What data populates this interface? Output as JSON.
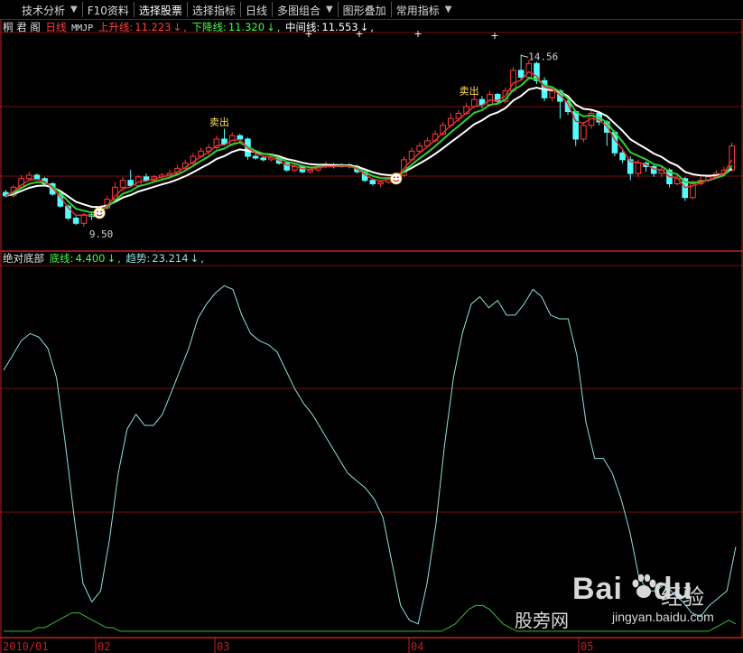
{
  "toolbar": {
    "items": [
      {
        "label": "技术分析",
        "dropdown": true
      },
      {
        "label": "F10资料",
        "dropdown": false
      },
      {
        "label": "选择股票",
        "dropdown": false,
        "selected": true
      },
      {
        "label": "选择指标",
        "dropdown": false
      },
      {
        "label": "日线",
        "dropdown": false
      },
      {
        "label": "多图组合",
        "dropdown": true
      },
      {
        "label": "图形叠加",
        "dropdown": false
      },
      {
        "label": "常用指标",
        "dropdown": true
      }
    ]
  },
  "main_panel": {
    "stock_name": "桐 君 阁",
    "period": "日线",
    "indicator": "MMJP",
    "up_label": "上升线:",
    "up_value": "11.223",
    "down_label": "下降线:",
    "down_value": "11.320",
    "mid_label": "中间线:",
    "mid_value": "11.553",
    "arrow": "↓",
    "comma": ",",
    "high_label": "14.56",
    "low_label": "9.50",
    "sell_label": "卖出"
  },
  "sub_panel": {
    "name": "绝对底部",
    "base_label": "底线:",
    "base_value": "4.400",
    "trend_label": "趋势:",
    "trend_value": "23.214",
    "arrow": "↓",
    "comma": ","
  },
  "x_axis": {
    "labels": [
      "2010/01",
      "02",
      "03",
      "04",
      "05"
    ]
  },
  "watermark": {
    "logo_text": "Bai",
    "logo_text2": "du",
    "right_text": "经验",
    "site_cn": "股旁网",
    "url": "jingyan.baidu.com"
  },
  "colors": {
    "up_candle": "#ff3c3c",
    "down_candle": "#54fcfc",
    "upper_line": "#e03030",
    "lower_line": "#30d030",
    "middle_line": "#ffffff",
    "trend_line": "#8ee0e0",
    "base_line": "#3ab83a",
    "grid": "#7a1010",
    "label_up": "#ff4040",
    "label_down": "#40ff40"
  },
  "chart_data": [
    {
      "type": "candlestick",
      "title": "桐 君 阁 日线 MMJP",
      "ylim": [
        9.0,
        15.2
      ],
      "high_marker": 14.56,
      "low_marker": 9.5,
      "candles": [
        [
          10.55,
          10.45,
          10.62,
          10.4
        ],
        [
          10.45,
          10.7,
          10.75,
          10.4
        ],
        [
          10.7,
          10.95,
          11.05,
          10.65
        ],
        [
          10.95,
          11.05,
          11.15,
          10.9
        ],
        [
          11.05,
          10.95,
          11.1,
          10.9
        ],
        [
          10.95,
          10.8,
          11.0,
          10.75
        ],
        [
          10.8,
          10.5,
          10.85,
          10.45
        ],
        [
          10.5,
          10.15,
          10.55,
          10.1
        ],
        [
          10.15,
          9.8,
          10.2,
          9.75
        ],
        [
          9.8,
          9.65,
          9.85,
          9.6
        ],
        [
          9.65,
          9.9,
          9.95,
          9.55
        ],
        [
          9.9,
          9.85,
          10.0,
          9.75
        ],
        [
          9.85,
          10.1,
          10.15,
          9.8
        ],
        [
          10.1,
          10.35,
          10.45,
          10.05
        ],
        [
          10.35,
          10.7,
          10.85,
          10.3
        ],
        [
          10.7,
          10.9,
          11.0,
          10.6
        ],
        [
          10.9,
          10.75,
          11.2,
          10.7
        ],
        [
          10.75,
          11.0,
          11.05,
          10.7
        ],
        [
          11.0,
          10.9,
          11.1,
          10.85
        ],
        [
          10.9,
          11.0,
          11.05,
          10.85
        ],
        [
          11.0,
          11.05,
          11.12,
          10.95
        ],
        [
          11.05,
          11.1,
          11.2,
          11.0
        ],
        [
          11.1,
          11.25,
          11.35,
          11.05
        ],
        [
          11.25,
          11.4,
          11.5,
          11.2
        ],
        [
          11.4,
          11.6,
          11.7,
          11.35
        ],
        [
          11.6,
          11.75,
          11.85,
          11.55
        ],
        [
          11.75,
          11.85,
          11.95,
          11.65
        ],
        [
          11.85,
          12.1,
          12.2,
          11.8
        ],
        [
          12.1,
          11.95,
          12.4,
          11.9
        ],
        [
          11.95,
          12.2,
          12.3,
          11.9
        ],
        [
          12.2,
          12.1,
          12.25,
          12.0
        ],
        [
          12.1,
          11.6,
          12.15,
          11.5
        ],
        [
          11.6,
          11.55,
          11.7,
          11.5
        ],
        [
          11.55,
          11.5,
          11.6,
          11.45
        ],
        [
          11.5,
          11.55,
          11.65,
          11.45
        ],
        [
          11.55,
          11.4,
          11.6,
          11.35
        ],
        [
          11.4,
          11.2,
          11.45,
          11.15
        ],
        [
          11.2,
          11.3,
          11.4,
          11.15
        ],
        [
          11.3,
          11.15,
          11.35,
          11.1
        ],
        [
          11.15,
          11.2,
          11.3,
          11.1
        ],
        [
          11.2,
          11.3,
          11.35,
          11.15
        ],
        [
          11.3,
          11.35,
          11.45,
          11.25
        ],
        [
          11.35,
          11.3,
          11.4,
          11.25
        ],
        [
          11.3,
          11.35,
          11.4,
          11.25
        ],
        [
          11.35,
          11.3,
          11.4,
          11.25
        ],
        [
          11.3,
          11.15,
          11.35,
          11.1
        ],
        [
          11.15,
          10.9,
          11.2,
          10.85
        ],
        [
          10.9,
          10.8,
          10.95,
          10.75
        ],
        [
          10.8,
          10.85,
          10.9,
          10.7
        ],
        [
          10.85,
          10.95,
          11.0,
          10.8
        ],
        [
          10.95,
          11.05,
          11.1,
          10.9
        ],
        [
          11.05,
          11.5,
          11.6,
          11.0
        ],
        [
          11.5,
          11.75,
          11.85,
          11.45
        ],
        [
          11.75,
          11.9,
          12.0,
          11.7
        ],
        [
          11.9,
          12.05,
          12.15,
          11.85
        ],
        [
          12.05,
          12.25,
          12.35,
          12.0
        ],
        [
          12.25,
          12.5,
          12.6,
          12.2
        ],
        [
          12.5,
          12.7,
          12.85,
          12.45
        ],
        [
          12.7,
          12.85,
          12.95,
          12.6
        ],
        [
          12.85,
          13.05,
          13.15,
          12.8
        ],
        [
          13.05,
          13.25,
          13.4,
          13.0
        ],
        [
          13.25,
          13.1,
          13.35,
          13.0
        ],
        [
          13.1,
          13.4,
          13.5,
          13.05
        ],
        [
          13.4,
          13.2,
          13.45,
          13.1
        ],
        [
          13.2,
          13.5,
          13.6,
          13.15
        ],
        [
          13.5,
          14.1,
          14.2,
          13.45
        ],
        [
          14.1,
          13.9,
          14.56,
          13.8
        ],
        [
          13.9,
          14.3,
          14.4,
          13.85
        ],
        [
          14.3,
          13.8,
          14.35,
          13.7
        ],
        [
          13.8,
          13.3,
          13.9,
          13.2
        ],
        [
          13.3,
          13.5,
          13.6,
          13.2
        ],
        [
          13.5,
          13.2,
          13.55,
          12.7
        ],
        [
          13.2,
          12.9,
          13.3,
          12.8
        ],
        [
          12.9,
          12.1,
          12.95,
          11.9
        ],
        [
          12.1,
          12.5,
          12.6,
          12.0
        ],
        [
          12.5,
          12.85,
          12.95,
          12.4
        ],
        [
          12.85,
          12.6,
          12.9,
          12.5
        ],
        [
          12.6,
          12.3,
          12.65,
          11.9
        ],
        [
          12.3,
          11.7,
          12.35,
          11.6
        ],
        [
          11.7,
          11.5,
          11.8,
          11.4
        ],
        [
          11.5,
          11.1,
          11.6,
          10.9
        ],
        [
          11.1,
          11.4,
          11.5,
          11.0
        ],
        [
          11.4,
          11.3,
          11.45,
          11.15
        ],
        [
          11.3,
          11.1,
          11.35,
          11.0
        ],
        [
          11.1,
          11.2,
          11.3,
          11.0
        ],
        [
          11.2,
          10.8,
          11.25,
          10.7
        ],
        [
          10.8,
          10.95,
          11.05,
          10.75
        ],
        [
          10.95,
          10.4,
          11.0,
          10.3
        ],
        [
          10.4,
          10.8,
          10.9,
          10.35
        ],
        [
          10.8,
          10.9,
          11.0,
          10.75
        ],
        [
          10.9,
          11.0,
          11.05,
          10.85
        ],
        [
          11.0,
          11.1,
          11.2,
          10.95
        ],
        [
          11.1,
          11.2,
          11.3,
          11.05
        ],
        [
          11.2,
          11.9,
          12.0,
          11.15
        ]
      ]
    },
    {
      "type": "line",
      "title": "绝对底部",
      "ylim": [
        0,
        100
      ],
      "series": [
        {
          "name": "底线",
          "values": [
            1,
            1,
            1,
            1,
            1,
            2,
            2,
            3,
            4,
            5,
            6,
            6,
            5,
            4,
            3,
            2,
            2,
            1,
            1,
            1,
            1,
            1,
            1,
            1,
            1,
            1,
            1,
            1,
            1,
            1,
            1,
            1,
            1,
            1,
            1,
            1,
            1,
            1,
            1,
            1,
            1,
            1,
            1,
            1,
            1,
            1,
            1,
            1,
            1,
            1,
            1,
            1,
            1,
            1,
            1,
            1,
            1,
            1,
            1,
            1,
            1,
            1,
            1,
            1,
            1,
            2,
            3,
            5,
            7,
            8,
            8,
            7,
            5,
            3,
            2,
            1,
            1,
            1,
            1,
            1,
            1,
            1,
            1,
            1,
            1,
            1,
            1,
            1,
            1,
            1,
            1,
            1,
            1,
            1,
            1,
            1,
            1,
            1,
            1,
            1,
            1,
            1,
            1,
            1,
            2,
            3,
            4,
            3
          ]
        },
        {
          "name": "趋势",
          "values": [
            72,
            76,
            80,
            82,
            81,
            78,
            70,
            52,
            32,
            14,
            9,
            12,
            26,
            44,
            56,
            60,
            57,
            57,
            60,
            66,
            72,
            78,
            86,
            90,
            93,
            95,
            94,
            87,
            82,
            80,
            79,
            77,
            72,
            67,
            63,
            60,
            56,
            52,
            48,
            44,
            42,
            40,
            37,
            32,
            20,
            8,
            4,
            3,
            14,
            30,
            52,
            70,
            82,
            90,
            92,
            89,
            91,
            87,
            87,
            90,
            94,
            92,
            87,
            86,
            86,
            76,
            58,
            48,
            48,
            44,
            37,
            28,
            16,
            12,
            12,
            14,
            11,
            9,
            6,
            5,
            8,
            10,
            12,
            24
          ]
        }
      ]
    }
  ]
}
